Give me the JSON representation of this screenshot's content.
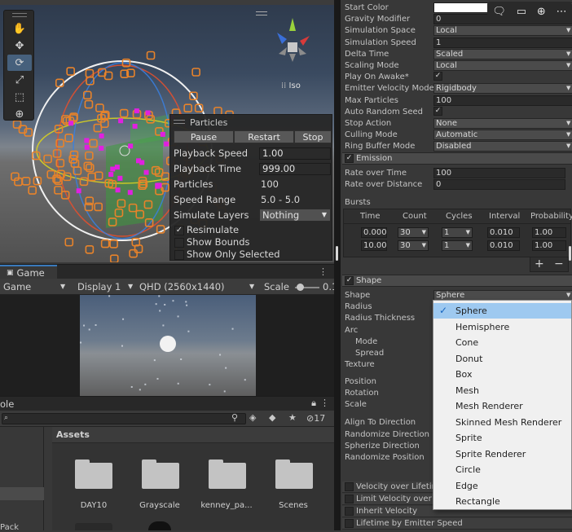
{
  "scene": {
    "iso_label": "Iso",
    "tools": [
      "hand-icon",
      "move-icon",
      "rotate-icon",
      "scale-icon",
      "rect-icon",
      "transform-icon"
    ]
  },
  "particles_panel": {
    "title": "Particles",
    "buttons": [
      "Pause",
      "Restart",
      "Stop"
    ],
    "rows": [
      {
        "label": "Playback Speed",
        "value": "1.00"
      },
      {
        "label": "Playback Time",
        "value": "999.00"
      },
      {
        "label": "Particles",
        "value": "100"
      },
      {
        "label": "Speed Range",
        "value": "5.0 - 5.0"
      },
      {
        "label": "Simulate Layers",
        "value": "Nothing"
      }
    ],
    "checks": [
      {
        "label": "Resimulate",
        "checked": true
      },
      {
        "label": "Show Bounds",
        "checked": false
      },
      {
        "label": "Show Only Selected",
        "checked": false
      }
    ]
  },
  "game": {
    "tab_label": "Game",
    "mode": "Game",
    "display": "Display 1",
    "resolution": "QHD (2560x1440)",
    "scale_label": "Scale",
    "scale_value": "0.1"
  },
  "project": {
    "tab_label": "ole",
    "count_badge": "17",
    "assets_header": "Assets",
    "left_label": "Pack",
    "folders": [
      "DAY10",
      "Grayscale",
      "kenney_pa...",
      "Scenes"
    ]
  },
  "inspector": {
    "rows_top": [
      {
        "label": "Start Color",
        "kind": "color",
        "value": ""
      },
      {
        "label": "Gravity Modifier",
        "kind": "val",
        "value": "0"
      },
      {
        "label": "Simulation Space",
        "kind": "dd",
        "value": "Local"
      },
      {
        "label": "Simulation Speed",
        "kind": "val",
        "value": "1"
      },
      {
        "label": "Delta Time",
        "kind": "dd",
        "value": "Scaled"
      },
      {
        "label": "Scaling Mode",
        "kind": "dd",
        "value": "Local"
      },
      {
        "label": "Play On Awake*",
        "kind": "cb",
        "value": "✓"
      },
      {
        "label": "Emitter Velocity Mode",
        "kind": "dd",
        "value": "Rigidbody"
      },
      {
        "label": "Max Particles",
        "kind": "val",
        "value": "100"
      },
      {
        "label": "Auto Random Seed",
        "kind": "cb",
        "value": "✓"
      },
      {
        "label": "Stop Action",
        "kind": "dd",
        "value": "None"
      },
      {
        "label": "Culling Mode",
        "kind": "dd",
        "value": "Automatic"
      },
      {
        "label": "Ring Buffer Mode",
        "kind": "dd",
        "value": "Disabled"
      }
    ],
    "emission": {
      "title": "Emission",
      "rate_time_label": "Rate over Time",
      "rate_time_value": "100",
      "rate_distance_label": "Rate over Distance",
      "rate_distance_value": "0",
      "bursts_label": "Bursts",
      "bursts_headers": [
        "Time",
        "Count",
        "Cycles",
        "Interval",
        "Probability"
      ],
      "bursts_rows": [
        {
          "time": "0.000",
          "count": "30",
          "cycles": "1",
          "interval": "0.010",
          "probability": "1.00"
        },
        {
          "time": "10.00",
          "count": "30",
          "cycles": "1",
          "interval": "0.010",
          "probability": "1.00"
        }
      ],
      "add": "+",
      "remove": "−"
    },
    "shape": {
      "title": "Shape",
      "shape_label": "Shape",
      "shape_value": "Sphere",
      "labels": [
        "Radius",
        "Radius Thickness",
        "Arc",
        "Mode",
        "Spread",
        "Texture",
        "Position",
        "Rotation",
        "Scale",
        "Align To Direction",
        "Randomize Direction",
        "Spherize Direction",
        "Randomize Position"
      ]
    },
    "modules": [
      "Velocity over Lifetime",
      "Limit Velocity over Lifetime",
      "Inherit Velocity",
      "Lifetime by Emitter Speed"
    ]
  },
  "shape_menu": {
    "items": [
      "Sphere",
      "Hemisphere",
      "Cone",
      "Donut",
      "Box",
      "Mesh",
      "Mesh Renderer",
      "Skinned Mesh Renderer",
      "Sprite",
      "Sprite Renderer",
      "Circle",
      "Edge",
      "Rectangle"
    ],
    "selected_index": 0
  },
  "colors": {
    "selection": "#9ec9f0",
    "accent_blue": "#3a79bb",
    "particle_orange": "#e8832a",
    "particle_magenta": "#e020e0"
  }
}
